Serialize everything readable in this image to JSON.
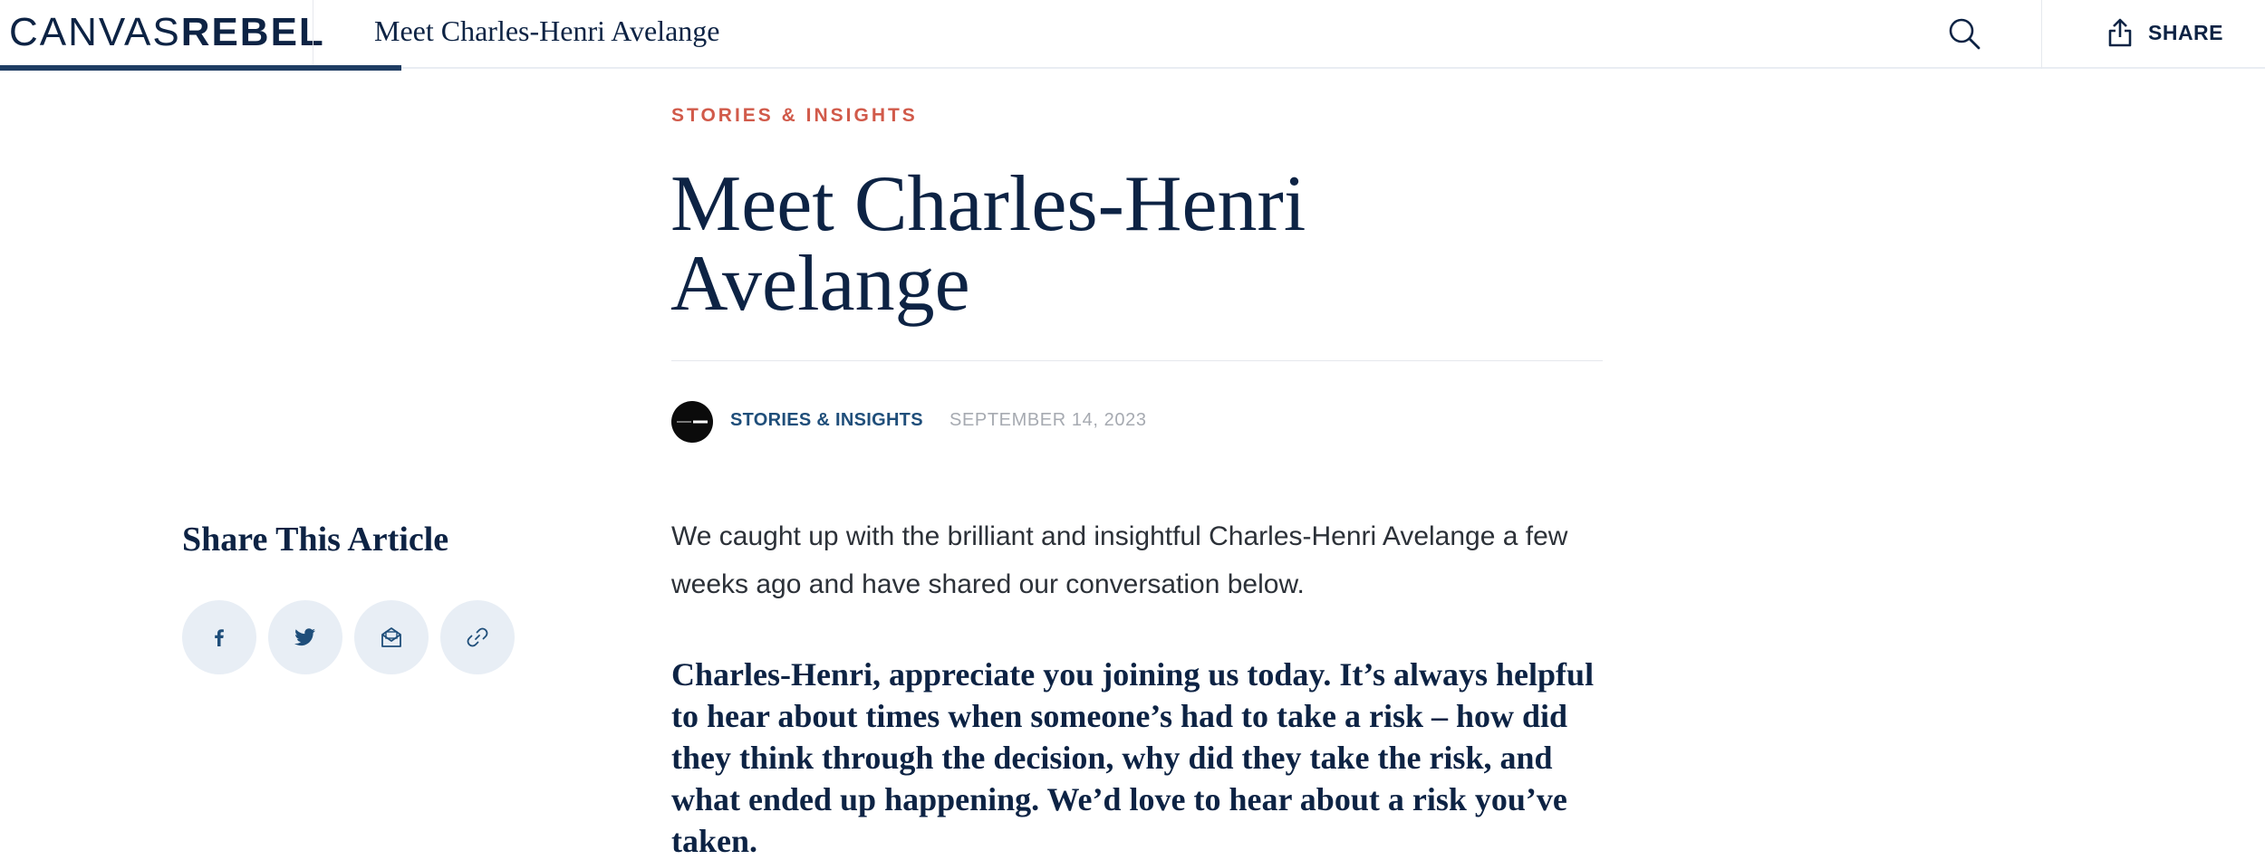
{
  "header": {
    "logo_light": "CANVAS",
    "logo_bold": "REBEL",
    "title": "Meet Charles-Henri Avelange",
    "share_label": "SHARE",
    "search_icon": "search-icon",
    "share_icon": "share-upload-icon"
  },
  "article": {
    "kicker": "STORIES & INSIGHTS",
    "title": "Meet Charles-Henri Avelange",
    "byline": {
      "avatar_icon": "canvasrebel-avatar",
      "category": "STORIES & INSIGHTS",
      "date": "SEPTEMBER 14, 2023"
    },
    "intro": "We caught up with the brilliant and insightful Charles-Henri Avelange a few weeks ago and have shared our conversation below.",
    "question": "Charles-Henri, appreciate you joining us today. It’s always helpful to hear about times when someone’s had to take a risk – how did they think through the decision, why did they take the risk, and what ended up happening. We’d love to hear about a risk you’ve taken."
  },
  "share_sidebar": {
    "heading": "Share This Article",
    "buttons": [
      {
        "name": "facebook",
        "icon": "facebook-icon"
      },
      {
        "name": "twitter",
        "icon": "twitter-icon"
      },
      {
        "name": "email",
        "icon": "email-icon"
      },
      {
        "name": "copy-link",
        "icon": "link-icon"
      }
    ]
  },
  "colors": {
    "navy": "#0d2344",
    "accent_red": "#d15a4a",
    "byline_blue": "#1f4e7a",
    "share_button_bg": "#e8eef5"
  }
}
